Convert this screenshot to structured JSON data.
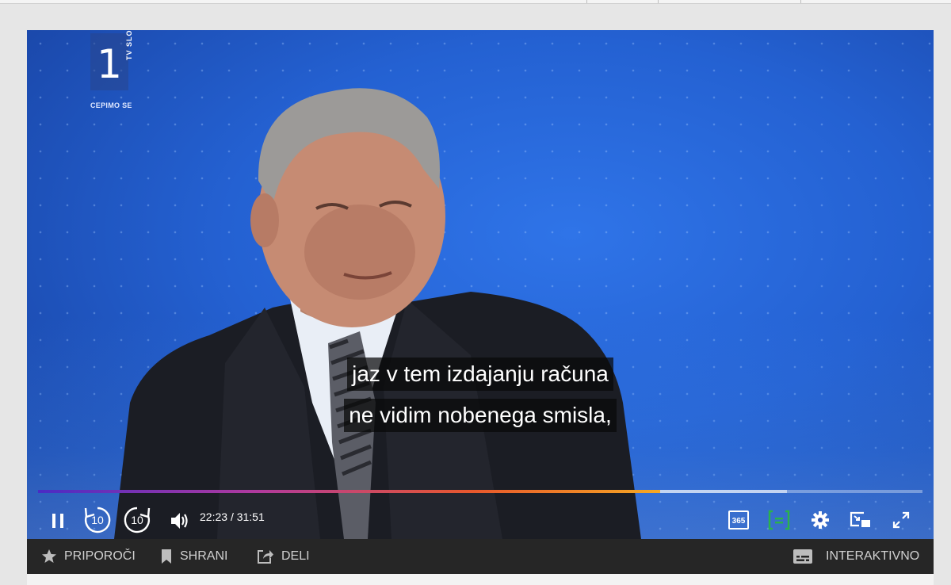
{
  "channel": {
    "number": "1",
    "name": "TV SLO",
    "tagline": "CEPIMO SE"
  },
  "subtitles": [
    "jaz v tem izdajanju računa",
    "ne vidim nobenega smisla,"
  ],
  "playback": {
    "current_time": "22:23",
    "separator": "/",
    "duration": "31:51",
    "played_fraction": 0.703,
    "buffered_fraction": 0.847,
    "skip_back_seconds": "10",
    "skip_forward_seconds": "10"
  },
  "player_icons": {
    "pause": "pause-icon",
    "rewind": "rewind-10-icon",
    "forward": "forward-10-icon",
    "volume": "volume-icon",
    "badge_365": "365",
    "subtitle_toggle": "subtitles-icon",
    "settings": "gear-icon",
    "pip": "picture-in-picture-icon",
    "fullscreen": "fullscreen-icon"
  },
  "actions": {
    "recommend": "PRIPOROČI",
    "save": "SHRANI",
    "share": "DELI",
    "interactive": "INTERAKTIVNO"
  },
  "colors": {
    "subtitle_toggle_accent": "#2bb34a",
    "progress_start": "#4a2bc4",
    "progress_end": "#f6a823",
    "action_bar": "#262626"
  }
}
